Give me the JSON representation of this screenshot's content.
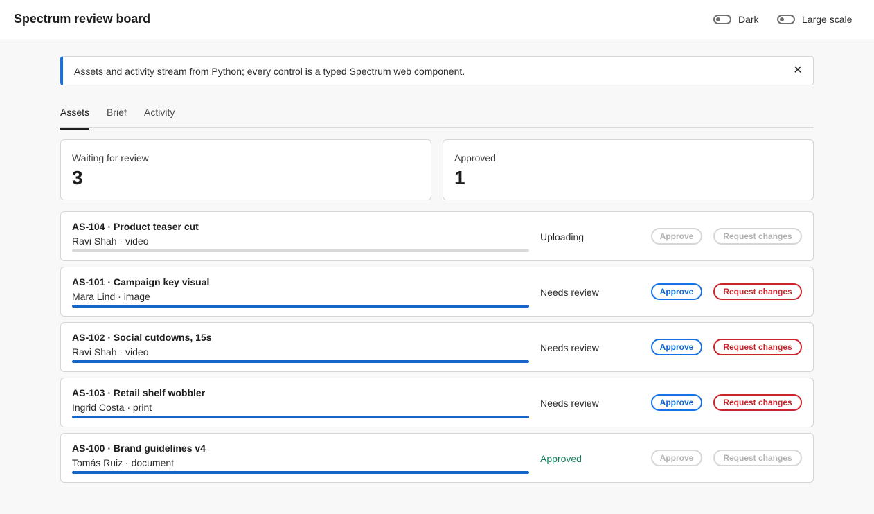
{
  "header": {
    "title": "Spectrum review board",
    "toggles": [
      {
        "label": "Dark",
        "checked": false
      },
      {
        "label": "Large scale",
        "checked": false
      }
    ]
  },
  "banner": {
    "text": "Assets and activity stream from Python; every control is a typed Spectrum web component.",
    "close_icon": "close-icon",
    "accent": "#1473e6"
  },
  "tabs": [
    {
      "label": "Assets",
      "selected": true
    },
    {
      "label": "Brief",
      "selected": false
    },
    {
      "label": "Activity",
      "selected": false
    }
  ],
  "stats": [
    {
      "label": "Waiting for review",
      "value": "3"
    },
    {
      "label": "Approved",
      "value": "1"
    }
  ],
  "actions": {
    "approve_label": "Approve",
    "request_label": "Request changes"
  },
  "assets": [
    {
      "title": "AS-104 · Product teaser cut",
      "meta": "Ravi Shah · video",
      "status": "Uploading",
      "progress": 0.0,
      "actions_enabled": false
    },
    {
      "title": "AS-101 · Campaign key visual",
      "meta": "Mara Lind · image",
      "status": "Needs review",
      "progress": 1.0,
      "actions_enabled": true
    },
    {
      "title": "AS-102 · Social cutdowns, 15s",
      "meta": "Ravi Shah · video",
      "status": "Needs review",
      "progress": 1.0,
      "actions_enabled": true
    },
    {
      "title": "AS-103 · Retail shelf wobbler",
      "meta": "Ingrid Costa · print",
      "status": "Needs review",
      "progress": 1.0,
      "actions_enabled": true
    },
    {
      "title": "AS-100 · Brand guidelines v4",
      "meta": "Tomás Ruiz · document",
      "status": "Approved",
      "progress": 1.0,
      "actions_enabled": false
    }
  ],
  "colors": {
    "accent": "#1473e6",
    "progress": "#1565c9",
    "negative": "#c9252d",
    "positive": "#12805c"
  }
}
